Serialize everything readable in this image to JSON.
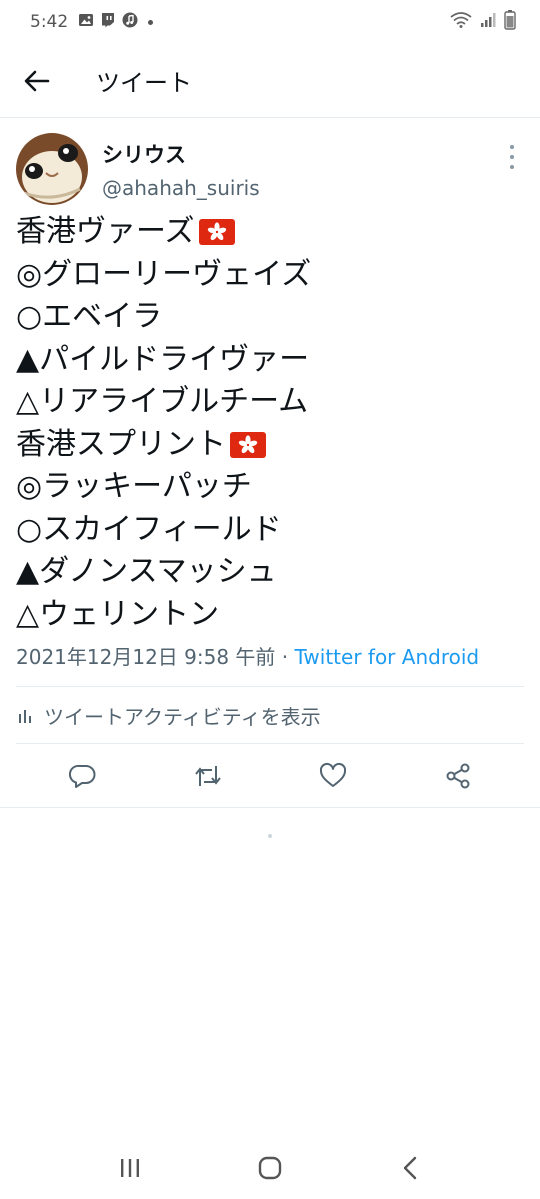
{
  "status_bar": {
    "time": "5:42"
  },
  "header": {
    "title": "ツイート"
  },
  "tweet": {
    "display_name": "シリウス",
    "handle": "@ahahah_suiris",
    "lines": [
      {
        "text": "香港ヴァーズ",
        "flag": true
      },
      {
        "text": "◎グローリーヴェイズ",
        "flag": false
      },
      {
        "text": "○エベイラ",
        "flag": false
      },
      {
        "text": "▲パイルドライヴァー",
        "flag": false
      },
      {
        "text": "△リアライブルチーム",
        "flag": false
      },
      {
        "text": "香港スプリント",
        "flag": true
      },
      {
        "text": "◎ラッキーパッチ",
        "flag": false
      },
      {
        "text": "○スカイフィールド",
        "flag": false
      },
      {
        "text": "▲ダノンスマッシュ",
        "flag": false
      },
      {
        "text": "△ウェリントン",
        "flag": false
      }
    ],
    "timestamp": "2021年12月12日 9:58 午前",
    "separator": " · ",
    "source": "Twitter for Android",
    "activity_label": "ツイートアクティビティを表示"
  },
  "colors": {
    "accent": "#1d9bf0",
    "secondary_text": "#536471",
    "hk_flag": "#de2910"
  },
  "icons": {
    "status_left": [
      "gallery-icon",
      "twitch-icon",
      "music-icon"
    ],
    "status_right": [
      "wifi-icon",
      "signal-icon",
      "battery-icon"
    ],
    "actions": [
      "reply-icon",
      "retweet-icon",
      "like-icon",
      "share-icon"
    ],
    "nav": [
      "recent-apps-icon",
      "home-icon",
      "back-icon"
    ]
  }
}
